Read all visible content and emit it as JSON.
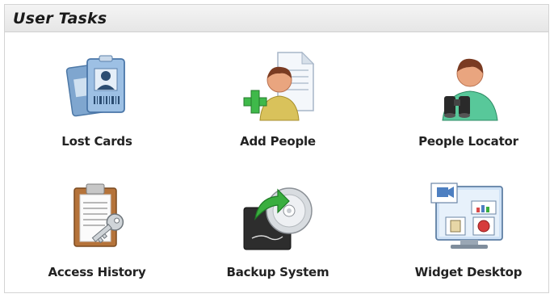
{
  "panel": {
    "title": "User Tasks"
  },
  "tasks": [
    {
      "label": "Lost Cards",
      "icon": "id-card-icon"
    },
    {
      "label": "Add People",
      "icon": "add-person-icon"
    },
    {
      "label": "People Locator",
      "icon": "person-binoculars-icon"
    },
    {
      "label": "Access History",
      "icon": "clipboard-key-icon"
    },
    {
      "label": "Backup System",
      "icon": "backup-disc-icon"
    },
    {
      "label": "Widget Desktop",
      "icon": "monitor-widgets-icon"
    }
  ]
}
